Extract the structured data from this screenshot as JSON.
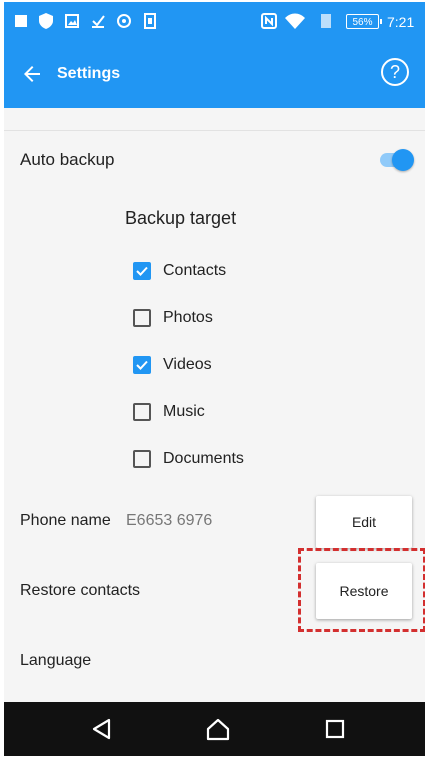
{
  "status_bar": {
    "icons": [
      "square-icon",
      "shield-icon",
      "image-icon",
      "download-icon",
      "settings-dot-icon",
      "sim-icon",
      "nfc-icon",
      "wifi-icon",
      "signal-icon"
    ],
    "battery": "56%",
    "time": "7:21"
  },
  "app_bar": {
    "title": "Settings",
    "help_icon": "?"
  },
  "auto_backup": {
    "label": "Auto backup",
    "enabled": true
  },
  "backup_target": {
    "title": "Backup target",
    "items": [
      {
        "label": "Contacts",
        "checked": true
      },
      {
        "label": "Photos",
        "checked": false
      },
      {
        "label": "Videos",
        "checked": true
      },
      {
        "label": "Music",
        "checked": false
      },
      {
        "label": "Documents",
        "checked": false
      }
    ]
  },
  "phone_name": {
    "label": "Phone name",
    "value": "E6653 6976",
    "button": "Edit"
  },
  "restore": {
    "label": "Restore contacts",
    "button": "Restore"
  },
  "language": {
    "label": "Language"
  },
  "colors": {
    "primary": "#2196f3",
    "highlight": "#d32f2f"
  }
}
